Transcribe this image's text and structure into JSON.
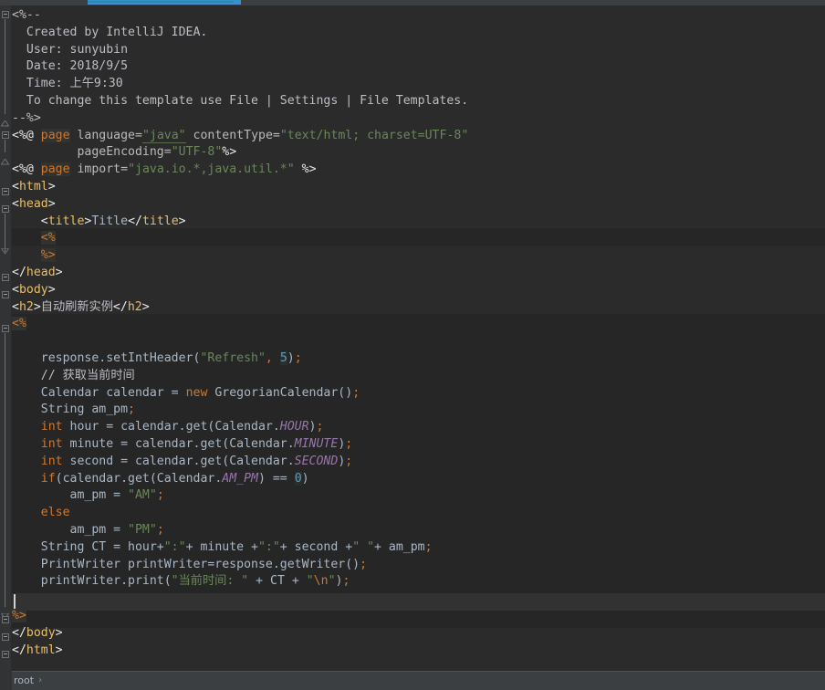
{
  "window": {
    "theme": "darcula",
    "accent_color": "#3592c4",
    "editor_bg": "#2b2b2b",
    "gutter_bg": "#313335",
    "scriptlet_bg": "#262626",
    "caret_line_bg": "#323232"
  },
  "tab": {
    "indicator_color": "#3592c4"
  },
  "breadcrumb": {
    "items": [
      "root"
    ],
    "separator": "›"
  },
  "code": {
    "language": "JSP",
    "lines": [
      {
        "n": 1,
        "segments": [
          {
            "t": "<%--",
            "c": "c-comment"
          }
        ]
      },
      {
        "n": 2,
        "segments": [
          {
            "t": "  Created by IntelliJ IDEA.",
            "c": "c-comment"
          }
        ]
      },
      {
        "n": 3,
        "segments": [
          {
            "t": "  User: sunyubin",
            "c": "c-comment"
          }
        ]
      },
      {
        "n": 4,
        "segments": [
          {
            "t": "  Date: 2018/9/5",
            "c": "c-comment"
          }
        ]
      },
      {
        "n": 5,
        "segments": [
          {
            "t": "  Time: 上午9:30",
            "c": "c-comment"
          }
        ]
      },
      {
        "n": 6,
        "segments": [
          {
            "t": "  To change this template use File | Settings | File Templates.",
            "c": "c-comment"
          }
        ]
      },
      {
        "n": 7,
        "segments": [
          {
            "t": "--%>",
            "c": "c-comment"
          }
        ]
      },
      {
        "n": 8,
        "segments": [
          {
            "t": "<%@ ",
            "c": "c-brk"
          },
          {
            "t": "page",
            "c": "c-kw-hl"
          },
          {
            "t": " ",
            "c": "c-text"
          },
          {
            "t": "language=",
            "c": "c-attr"
          },
          {
            "t": "\"java\"",
            "c": "c-strlink"
          },
          {
            "t": " ",
            "c": "c-text"
          },
          {
            "t": "contentType=",
            "c": "c-attr"
          },
          {
            "t": "\"text/html; charset=UTF-8\"",
            "c": "c-str"
          }
        ]
      },
      {
        "n": 9,
        "segments": [
          {
            "t": "         ",
            "c": "c-text"
          },
          {
            "t": "pageEncoding=",
            "c": "c-attr"
          },
          {
            "t": "\"UTF-8\"",
            "c": "c-str"
          },
          {
            "t": "%>",
            "c": "c-brk"
          }
        ]
      },
      {
        "n": 10,
        "segments": [
          {
            "t": "<%@ ",
            "c": "c-brk"
          },
          {
            "t": "page",
            "c": "c-kw-hl"
          },
          {
            "t": " ",
            "c": "c-text"
          },
          {
            "t": "import=",
            "c": "c-attr"
          },
          {
            "t": "\"java.io.*,java.util.*\"",
            "c": "c-str"
          },
          {
            "t": " %>",
            "c": "c-brk"
          }
        ]
      },
      {
        "n": 11,
        "segments": [
          {
            "t": "<",
            "c": "c-brk"
          },
          {
            "t": "html",
            "c": "c-tag"
          },
          {
            "t": ">",
            "c": "c-brk"
          }
        ]
      },
      {
        "n": 12,
        "segments": [
          {
            "t": "<",
            "c": "c-brk"
          },
          {
            "t": "head",
            "c": "c-tag"
          },
          {
            "t": ">",
            "c": "c-brk"
          }
        ]
      },
      {
        "n": 13,
        "segments": [
          {
            "t": "    <",
            "c": "c-brk"
          },
          {
            "t": "title",
            "c": "c-tag"
          },
          {
            "t": ">",
            "c": "c-brk"
          },
          {
            "t": "Title",
            "c": "c-text"
          },
          {
            "t": "</",
            "c": "c-brk"
          },
          {
            "t": "title",
            "c": "c-tag"
          },
          {
            "t": ">",
            "c": "c-brk"
          }
        ]
      },
      {
        "n": 14,
        "segments": [
          {
            "t": "    ",
            "c": "c-text"
          },
          {
            "t": "<%",
            "c": "c-jsp-hl"
          }
        ]
      },
      {
        "n": 15,
        "segments": [
          {
            "t": "    ",
            "c": "c-text"
          },
          {
            "t": "%>",
            "c": "c-jsp-hl"
          }
        ]
      },
      {
        "n": 16,
        "segments": [
          {
            "t": "</",
            "c": "c-brk"
          },
          {
            "t": "head",
            "c": "c-tag"
          },
          {
            "t": ">",
            "c": "c-brk"
          }
        ]
      },
      {
        "n": 17,
        "segments": [
          {
            "t": "<",
            "c": "c-brk"
          },
          {
            "t": "body",
            "c": "c-tag"
          },
          {
            "t": ">",
            "c": "c-brk"
          }
        ]
      },
      {
        "n": 18,
        "segments": [
          {
            "t": "<",
            "c": "c-brk"
          },
          {
            "t": "h2",
            "c": "c-tag"
          },
          {
            "t": ">",
            "c": "c-brk"
          },
          {
            "t": "自动刷新实例",
            "c": "c-cn"
          },
          {
            "t": "</",
            "c": "c-brk"
          },
          {
            "t": "h2",
            "c": "c-tag"
          },
          {
            "t": ">",
            "c": "c-brk"
          }
        ]
      },
      {
        "n": 19,
        "segments": [
          {
            "t": "<%",
            "c": "c-jsp-hl"
          }
        ]
      },
      {
        "n": 20,
        "segments": []
      },
      {
        "n": 21,
        "segments": [
          {
            "t": "    response.setIntHeader(",
            "c": "c-text"
          },
          {
            "t": "\"Refresh\"",
            "c": "c-str"
          },
          {
            "t": ",",
            "c": "c-semi"
          },
          {
            "t": " ",
            "c": "c-text"
          },
          {
            "t": "5",
            "c": "c-num"
          },
          {
            "t": ")",
            "c": "c-text"
          },
          {
            "t": ";",
            "c": "c-semi"
          }
        ]
      },
      {
        "n": 22,
        "segments": [
          {
            "t": "    // 获取当前时间",
            "c": "c-comment"
          }
        ]
      },
      {
        "n": 23,
        "segments": [
          {
            "t": "    Calendar calendar = ",
            "c": "c-text"
          },
          {
            "t": "new",
            "c": "c-kw"
          },
          {
            "t": " GregorianCalendar()",
            "c": "c-text"
          },
          {
            "t": ";",
            "c": "c-semi"
          }
        ]
      },
      {
        "n": 24,
        "segments": [
          {
            "t": "    String am_pm",
            "c": "c-text"
          },
          {
            "t": ";",
            "c": "c-semi"
          }
        ]
      },
      {
        "n": 25,
        "segments": [
          {
            "t": "    ",
            "c": "c-text"
          },
          {
            "t": "int",
            "c": "c-kw"
          },
          {
            "t": " hour = calendar.get(Calendar.",
            "c": "c-text"
          },
          {
            "t": "HOUR",
            "c": "c-static"
          },
          {
            "t": ")",
            "c": "c-text"
          },
          {
            "t": ";",
            "c": "c-semi"
          }
        ]
      },
      {
        "n": 26,
        "segments": [
          {
            "t": "    ",
            "c": "c-text"
          },
          {
            "t": "int",
            "c": "c-kw"
          },
          {
            "t": " minute = calendar.get(Calendar.",
            "c": "c-text"
          },
          {
            "t": "MINUTE",
            "c": "c-static"
          },
          {
            "t": ")",
            "c": "c-text"
          },
          {
            "t": ";",
            "c": "c-semi"
          }
        ]
      },
      {
        "n": 27,
        "segments": [
          {
            "t": "    ",
            "c": "c-text"
          },
          {
            "t": "int",
            "c": "c-kw"
          },
          {
            "t": " second = calendar.get(Calendar.",
            "c": "c-text"
          },
          {
            "t": "SECOND",
            "c": "c-static"
          },
          {
            "t": ")",
            "c": "c-text"
          },
          {
            "t": ";",
            "c": "c-semi"
          }
        ]
      },
      {
        "n": 28,
        "segments": [
          {
            "t": "    ",
            "c": "c-text"
          },
          {
            "t": "if",
            "c": "c-kw"
          },
          {
            "t": "(calendar.get(Calendar.",
            "c": "c-text"
          },
          {
            "t": "AM_PM",
            "c": "c-static"
          },
          {
            "t": ") == ",
            "c": "c-text"
          },
          {
            "t": "0",
            "c": "c-num"
          },
          {
            "t": ")",
            "c": "c-text"
          }
        ]
      },
      {
        "n": 29,
        "segments": [
          {
            "t": "        am_pm = ",
            "c": "c-text"
          },
          {
            "t": "\"AM\"",
            "c": "c-str"
          },
          {
            "t": ";",
            "c": "c-semi"
          }
        ]
      },
      {
        "n": 30,
        "segments": [
          {
            "t": "    ",
            "c": "c-text"
          },
          {
            "t": "else",
            "c": "c-kw"
          }
        ]
      },
      {
        "n": 31,
        "segments": [
          {
            "t": "        am_pm = ",
            "c": "c-text"
          },
          {
            "t": "\"PM\"",
            "c": "c-str"
          },
          {
            "t": ";",
            "c": "c-semi"
          }
        ]
      },
      {
        "n": 32,
        "segments": [
          {
            "t": "    String CT = hour+",
            "c": "c-text"
          },
          {
            "t": "\":\"",
            "c": "c-str"
          },
          {
            "t": "+ minute +",
            "c": "c-text"
          },
          {
            "t": "\":\"",
            "c": "c-str"
          },
          {
            "t": "+ second +",
            "c": "c-text"
          },
          {
            "t": "\" \"",
            "c": "c-str"
          },
          {
            "t": "+ am_pm",
            "c": "c-text"
          },
          {
            "t": ";",
            "c": "c-semi"
          }
        ]
      },
      {
        "n": 33,
        "segments": [
          {
            "t": "    PrintWriter printWriter=response.getWriter()",
            "c": "c-text"
          },
          {
            "t": ";",
            "c": "c-semi"
          }
        ]
      },
      {
        "n": 34,
        "segments": [
          {
            "t": "    printWriter.print(",
            "c": "c-text"
          },
          {
            "t": "\"当前时间: \"",
            "c": "c-str"
          },
          {
            "t": " + CT + ",
            "c": "c-text"
          },
          {
            "t": "\"",
            "c": "c-str"
          },
          {
            "t": "\\n",
            "c": "c-esc"
          },
          {
            "t": "\"",
            "c": "c-str"
          },
          {
            "t": ")",
            "c": "c-text"
          },
          {
            "t": ";",
            "c": "c-semi"
          }
        ]
      },
      {
        "n": 35,
        "segments": []
      },
      {
        "n": 36,
        "segments": [
          {
            "t": "%>",
            "c": "c-jsp-hl"
          }
        ]
      },
      {
        "n": 37,
        "segments": [
          {
            "t": "</",
            "c": "c-brk"
          },
          {
            "t": "body",
            "c": "c-tag"
          },
          {
            "t": ">",
            "c": "c-brk"
          }
        ]
      },
      {
        "n": 38,
        "segments": [
          {
            "t": "</",
            "c": "c-brk"
          },
          {
            "t": "html",
            "c": "c-tag"
          },
          {
            "t": ">",
            "c": "c-brk"
          }
        ]
      }
    ]
  }
}
